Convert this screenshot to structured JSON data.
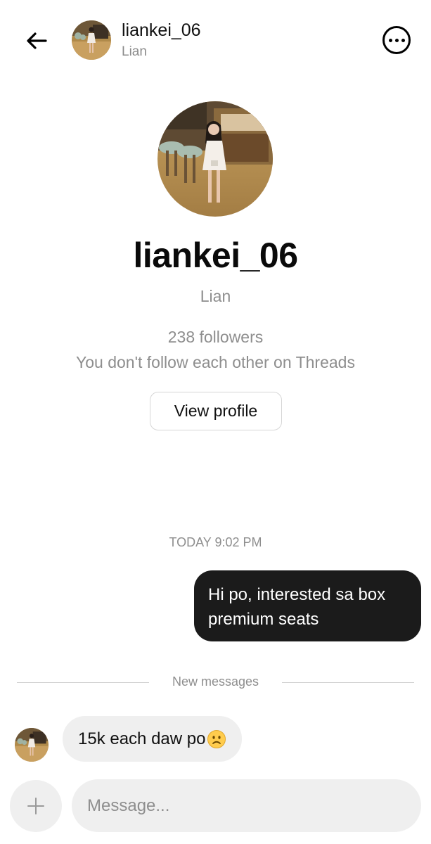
{
  "header": {
    "username": "liankei_06",
    "name": "Lian",
    "back_icon": "arrow-left-icon",
    "more_icon": "more-horizontal-icon"
  },
  "profile": {
    "username": "liankei_06",
    "name": "Lian",
    "followers": "238 followers",
    "relation": "You don't follow each other on Threads",
    "view_profile_label": "View profile"
  },
  "conversation": {
    "timestamp": "TODAY 9:02 PM",
    "outgoing_line1": "Hi po, interested sa box",
    "outgoing_line2": "premium seats",
    "new_messages_label": "New messages",
    "incoming_text": "15k each daw po",
    "incoming_emoji": "frowning-face-emoji"
  },
  "composer": {
    "placeholder": "Message...",
    "add_icon": "plus-icon"
  },
  "colors": {
    "outgoing_bubble": "#1b1b1b",
    "incoming_bubble": "#efefef",
    "secondary_text": "#8e8e8e"
  }
}
